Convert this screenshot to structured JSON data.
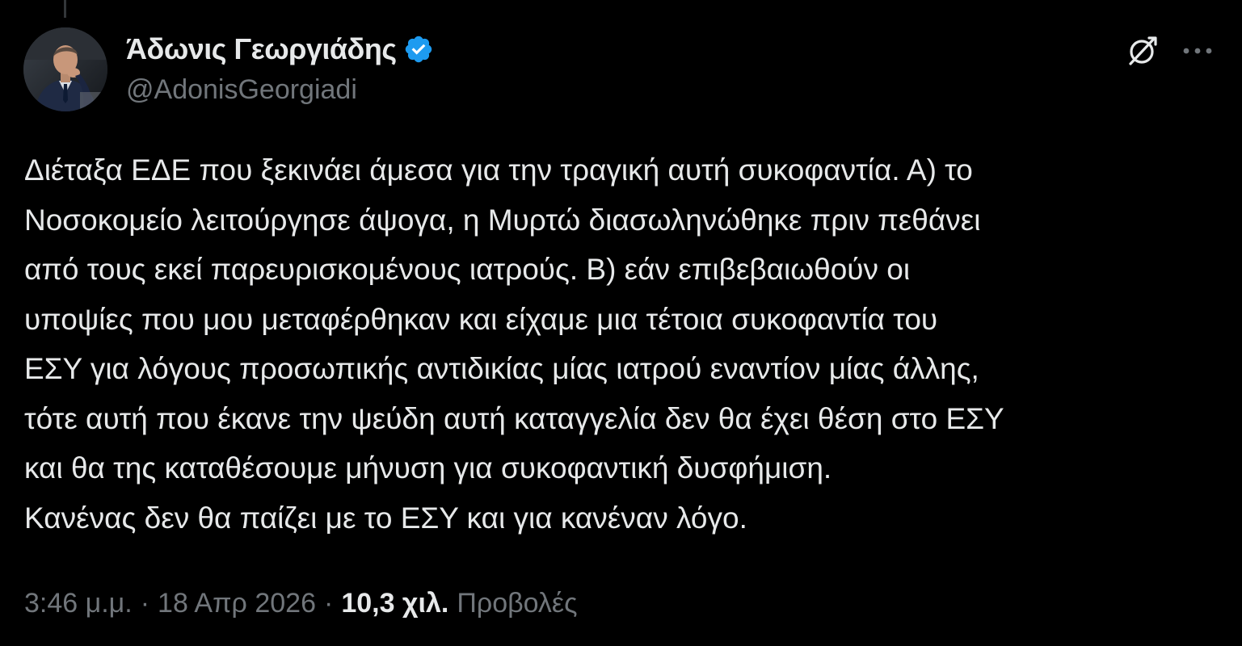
{
  "tweet": {
    "author": {
      "display_name": "Άδωνις Γεωργιάδης",
      "handle": "@AdonisGeorgiadi",
      "verified": true,
      "verified_color": "#1d9bf0",
      "avatar_icon": "profile-photo"
    },
    "actions": {
      "grok_icon": "grok-icon",
      "more_icon": "more-options-icon"
    },
    "text_lines": [
      "Διέταξα ΕΔΕ που ξεκινάει άμεσα για την τραγική αυτή συκοφαντία. Α) το",
      "Νοσοκομείο λειτούργησε άψογα, η Μυρτώ διασωληνώθηκε πριν πεθάνει",
      "από τους εκεί παρευρισκομένους ιατρούς. Β) εάν επιβεβαιωθούν οι",
      "υποψίες που μου μεταφέρθηκαν και είχαμε μια τέτοια συκοφαντία του",
      "ΕΣΥ για λόγους προσωπικής αντιδικίας μίας ιατρού εναντίον μίας άλλης,",
      "τότε αυτή που έκανε την ψεύδη αυτή καταγγελία δεν θα έχει θέση στο ΕΣΥ",
      "και θα της καταθέσουμε μήνυση για συκοφαντική δυσφήμιση.",
      "Κανένας δεν θα παίζει με το ΕΣΥ και για κανέναν λόγο."
    ],
    "meta": {
      "time": "3:46 μ.μ.",
      "separator": "·",
      "date": "18 Απρ 2026",
      "views_count": "10,3 χιλ.",
      "views_label": "Προβολές"
    }
  },
  "colors": {
    "background": "#000000",
    "primary_text": "#e7e9ea",
    "secondary_text": "#71767b",
    "accent": "#1d9bf0"
  }
}
